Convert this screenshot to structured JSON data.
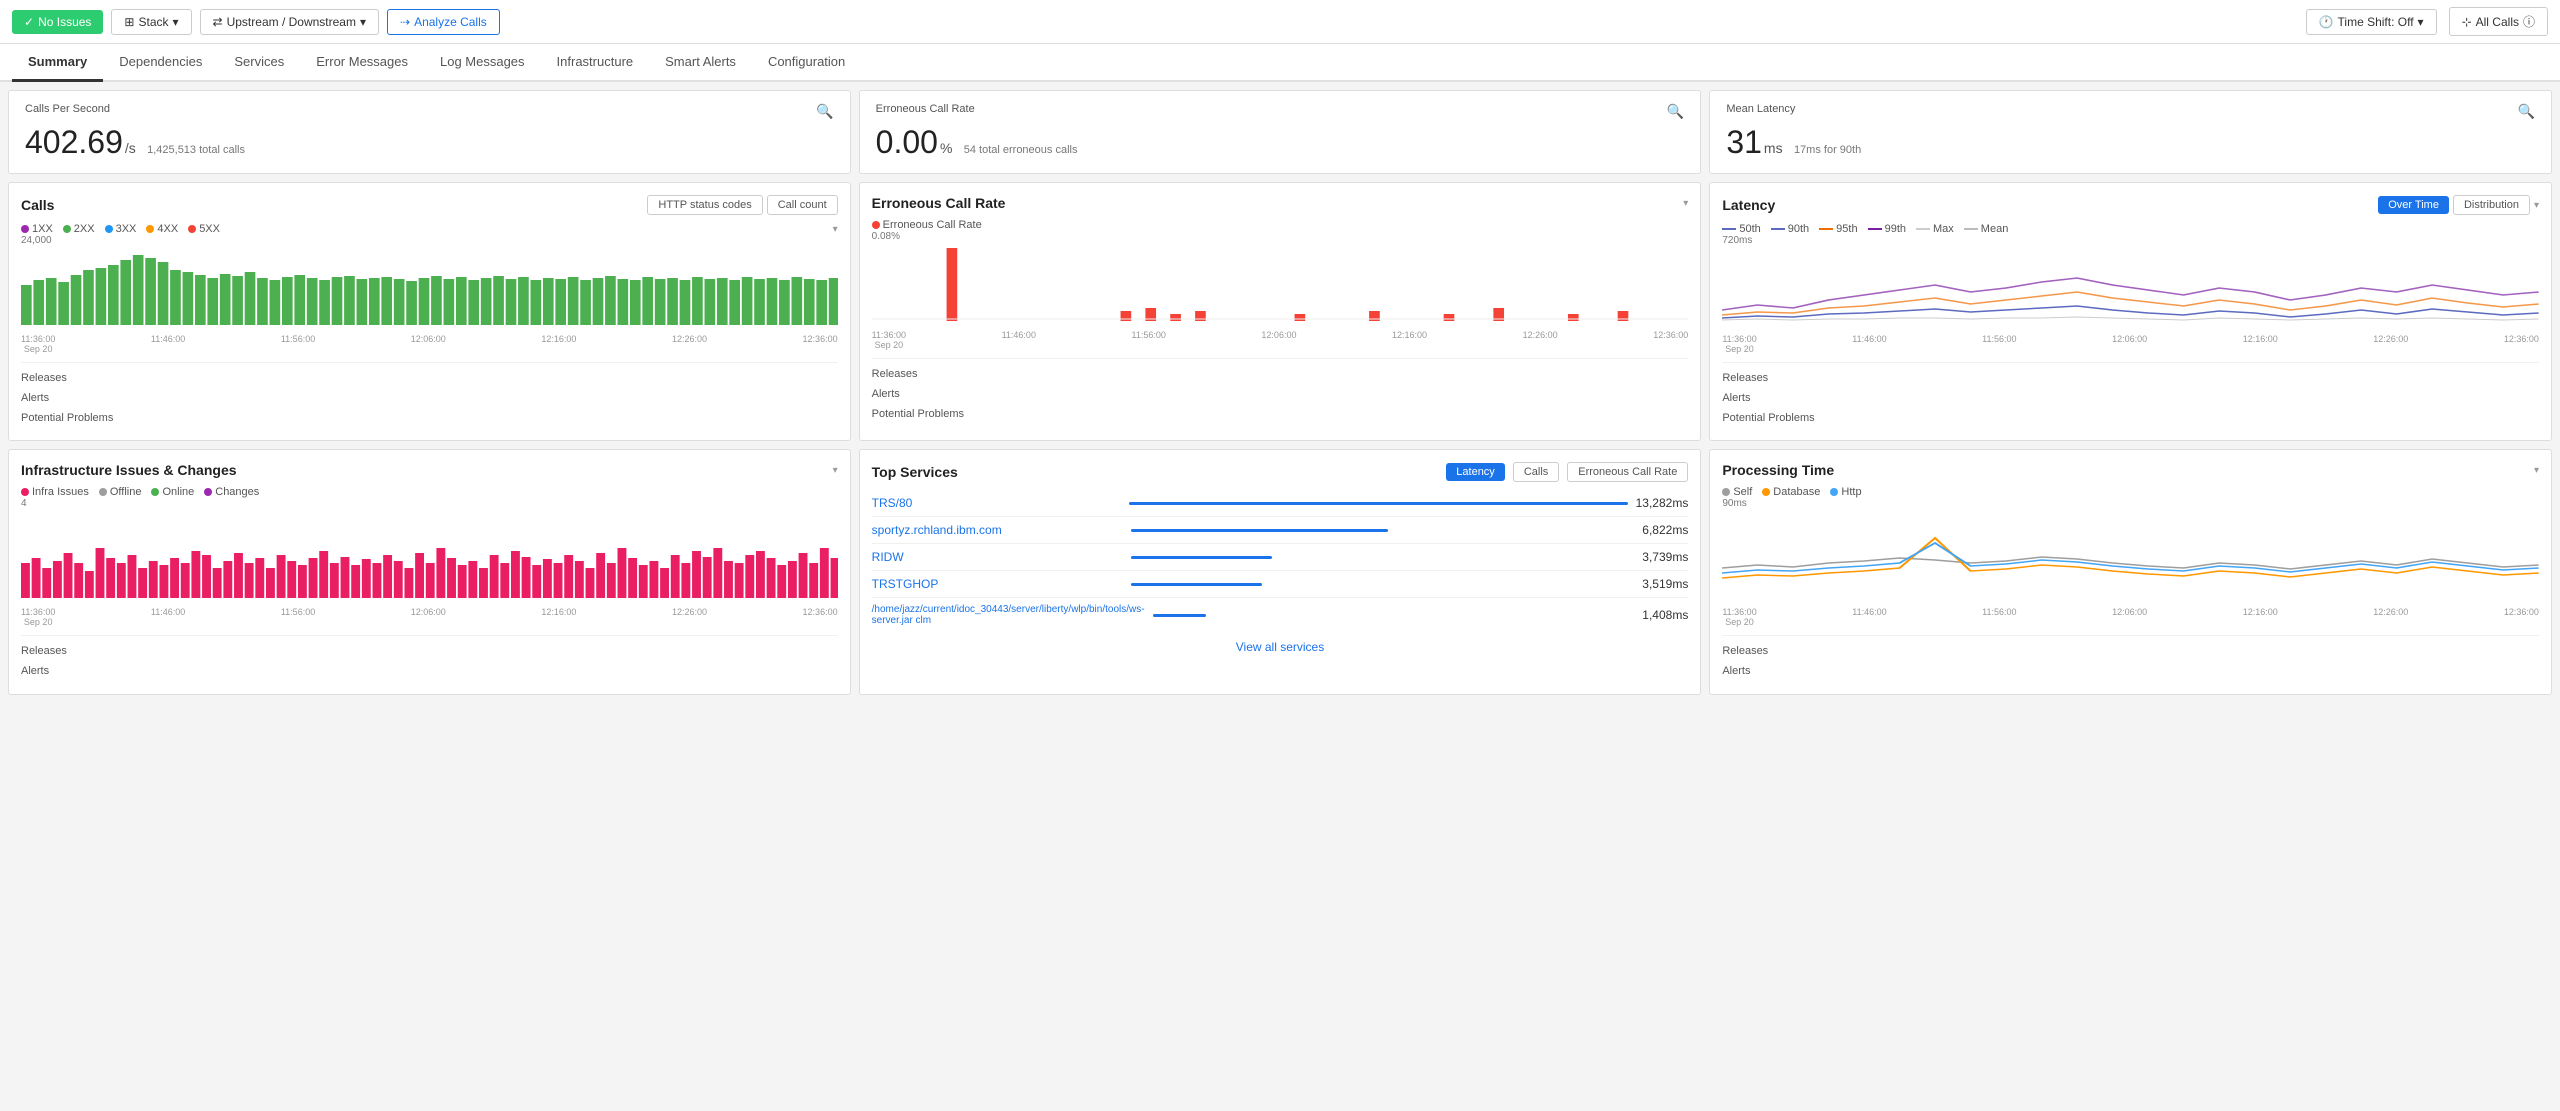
{
  "toolbar": {
    "no_issues_label": "No Issues",
    "stack_label": "Stack",
    "upstream_downstream_label": "Upstream / Downstream",
    "analyze_calls_label": "Analyze Calls",
    "time_shift_label": "Time Shift: Off",
    "all_calls_label": "All Calls"
  },
  "nav": {
    "tabs": [
      "Summary",
      "Dependencies",
      "Services",
      "Error Messages",
      "Log Messages",
      "Infrastructure",
      "Smart Alerts",
      "Configuration"
    ],
    "active": "Summary"
  },
  "stats": {
    "cps": {
      "label": "Calls Per Second",
      "value": "402.69",
      "unit": "/s",
      "sub": "1,425,513 total calls"
    },
    "ecr": {
      "label": "Erroneous Call Rate",
      "value": "0.00",
      "unit": "%",
      "sub": "54 total erroneous calls"
    },
    "latency": {
      "label": "Mean Latency",
      "value": "31",
      "unit": "ms",
      "sub": "17ms for 90th"
    }
  },
  "calls_card": {
    "title": "Calls",
    "btn1": "HTTP status codes",
    "btn2": "Call count",
    "y_label": "24,000",
    "legend": [
      {
        "label": "1XX",
        "color": "#9c27b0"
      },
      {
        "label": "2XX",
        "color": "#4caf50"
      },
      {
        "label": "3XX",
        "color": "#2196f3"
      },
      {
        "label": "4XX",
        "color": "#ff9800"
      },
      {
        "label": "5XX",
        "color": "#f44336"
      }
    ],
    "x_labels": [
      "11:36:00\nSep 20",
      "11:46:00",
      "11:56:00",
      "12:06:00",
      "12:16:00",
      "12:26:00",
      "12:36:00"
    ],
    "footer": [
      "Releases",
      "Alerts",
      "Potential Problems"
    ]
  },
  "ecr_card": {
    "title": "Erroneous Call Rate",
    "legend_label": "Erroneous Call Rate",
    "y_label": "0.08%",
    "x_labels": [
      "11:36:00\nSep 20",
      "11:46:00",
      "11:56:00",
      "12:06:00",
      "12:16:00",
      "12:26:00",
      "12:36:00"
    ],
    "footer": [
      "Releases",
      "Alerts",
      "Potential Problems"
    ]
  },
  "latency_card": {
    "title": "Latency",
    "btn1": "Over Time",
    "btn2": "Distribution",
    "legend": [
      {
        "label": "50th",
        "color": "#5c6bc0"
      },
      {
        "label": "90th",
        "color": "#5c6bc0"
      },
      {
        "label": "95th",
        "color": "#ef6c00"
      },
      {
        "label": "99th",
        "color": "#7b1fa2"
      },
      {
        "label": "Max",
        "color": "#ccc"
      },
      {
        "label": "Mean",
        "color": "#bbb"
      }
    ],
    "y_label": "720ms",
    "x_labels": [
      "11:36:00\nSep 20",
      "11:46:00",
      "11:56:00",
      "12:06:00",
      "12:16:00",
      "12:26:00",
      "12:36:00"
    ],
    "footer": [
      "Releases",
      "Alerts",
      "Potential Problems"
    ]
  },
  "infra_card": {
    "title": "Infrastructure Issues & Changes",
    "legend": [
      {
        "label": "Infra Issues",
        "color": "#e91e63"
      },
      {
        "label": "Offline",
        "color": "#9e9e9e"
      },
      {
        "label": "Online",
        "color": "#4caf50"
      },
      {
        "label": "Changes",
        "color": "#9c27b0"
      }
    ],
    "y_label": "4",
    "x_labels": [
      "11:36:00\nSep 20",
      "11:46:00",
      "11:56:00",
      "12:06:00",
      "12:16:00",
      "12:26:00",
      "12:36:00"
    ],
    "footer": [
      "Releases",
      "Alerts"
    ]
  },
  "top_services": {
    "title": "Top Services",
    "tabs": [
      "Latency",
      "Calls",
      "Erroneous Call Rate"
    ],
    "active_tab": "Latency",
    "services": [
      {
        "name": "TRS/80",
        "value": "13,282ms",
        "pct": 100
      },
      {
        "name": "sportyz.rchland.ibm.com",
        "value": "6,822ms",
        "pct": 51
      },
      {
        "name": "RIDW",
        "value": "3,739ms",
        "pct": 28
      },
      {
        "name": "TRSTGHOP",
        "value": "3,519ms",
        "pct": 26
      },
      {
        "name": "/home/jazz/current/idoc_30443/server/liberty/wlp/bin/tools/ws-server.jar clm",
        "value": "1,408ms",
        "pct": 11
      }
    ],
    "view_all": "View all services"
  },
  "processing_card": {
    "title": "Processing Time",
    "legend": [
      {
        "label": "Self",
        "color": "#9e9e9e"
      },
      {
        "label": "Database",
        "color": "#ff9800"
      },
      {
        "label": "Http",
        "color": "#42a5f5"
      }
    ],
    "y_label": "90ms",
    "x_labels": [
      "11:36:00\nSep 20",
      "11:46:00",
      "11:56:00",
      "12:06:00",
      "12:16:00",
      "12:26:00",
      "12:36:00"
    ],
    "footer": [
      "Releases",
      "Alerts"
    ]
  }
}
